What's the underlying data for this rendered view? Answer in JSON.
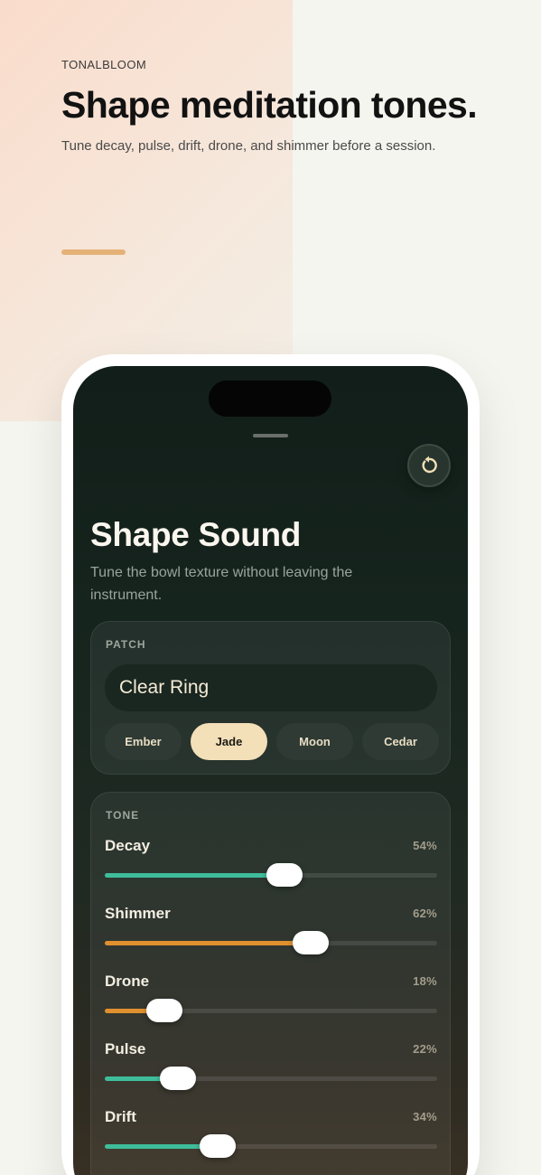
{
  "hero": {
    "brand": "TONALBLOOM",
    "headline": "Shape meditation tones.",
    "subline": "Tune decay, pulse, drift, drone, and shimmer before a session."
  },
  "sheet": {
    "title": "Shape Sound",
    "subtitle": "Tune the bowl texture without leaving the instrument.",
    "reset_icon": "reset-icon"
  },
  "patch": {
    "label": "PATCH",
    "value": "Clear Ring",
    "chips": [
      {
        "label": "Ember",
        "active": false
      },
      {
        "label": "Jade",
        "active": true
      },
      {
        "label": "Moon",
        "active": false
      },
      {
        "label": "Cedar",
        "active": false
      }
    ]
  },
  "tone": {
    "label": "TONE",
    "sliders": [
      {
        "name": "Decay",
        "value_text": "54%",
        "value": 0.54,
        "color": "#3fbd9b"
      },
      {
        "name": "Shimmer",
        "value_text": "62%",
        "value": 0.62,
        "color": "#e0902e"
      },
      {
        "name": "Drone",
        "value_text": "18%",
        "value": 0.18,
        "color": "#e0902e"
      },
      {
        "name": "Pulse",
        "value_text": "22%",
        "value": 0.22,
        "color": "#3fbd9b"
      },
      {
        "name": "Drift",
        "value_text": "34%",
        "value": 0.34,
        "color": "#3fbd9b"
      }
    ]
  },
  "colors": {
    "accent_gold": "#e4b277",
    "teal": "#3fbd9b",
    "amber": "#e0902e",
    "chip_active": "#f3dfb8"
  }
}
